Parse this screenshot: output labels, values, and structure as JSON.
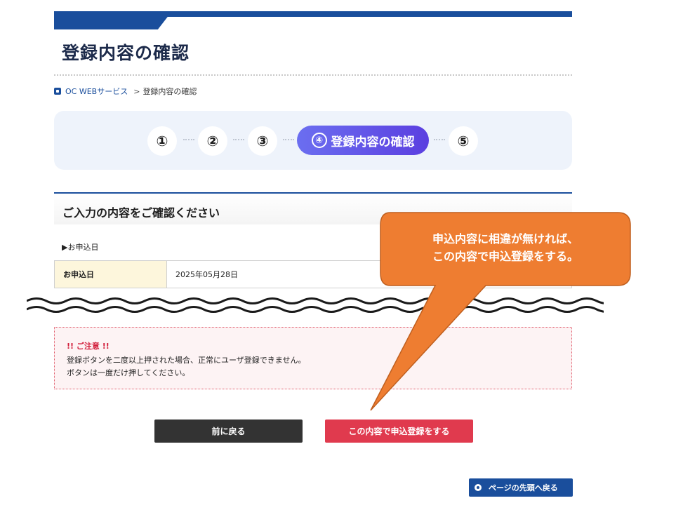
{
  "header": {
    "title": "登録内容の確認"
  },
  "breadcrumb": {
    "home": "OC WEBサービス",
    "separator": ">",
    "current": "登録内容の確認"
  },
  "stepper": {
    "steps": [
      "①",
      "②",
      "③",
      "④",
      "⑤"
    ],
    "active_number": "④",
    "active_label": "登録内容の確認"
  },
  "section": {
    "heading": "ご入力の内容をご確認ください",
    "subsection": "▶お申込日"
  },
  "table": {
    "label": "お申込日",
    "value": "2025年05月28日"
  },
  "notice": {
    "title": "!! ご注意 !!",
    "line1": "登録ボタンを二度以上押された場合、正常にユーザ登録できません。",
    "line2": "ボタンは一度だけ押してください。"
  },
  "buttons": {
    "back": "前に戻る",
    "submit": "この内容で申込登録をする"
  },
  "pagetop": {
    "label": "ページの先頭へ戻る"
  },
  "callout": {
    "line1": "申込内容に相違が無ければ、",
    "line2": "この内容で申込登録をする。"
  },
  "colors": {
    "brand": "#1a4e9c",
    "accent": "#e03a4e",
    "callout": "#ee7d31",
    "step_active": "#5b3fe0"
  }
}
